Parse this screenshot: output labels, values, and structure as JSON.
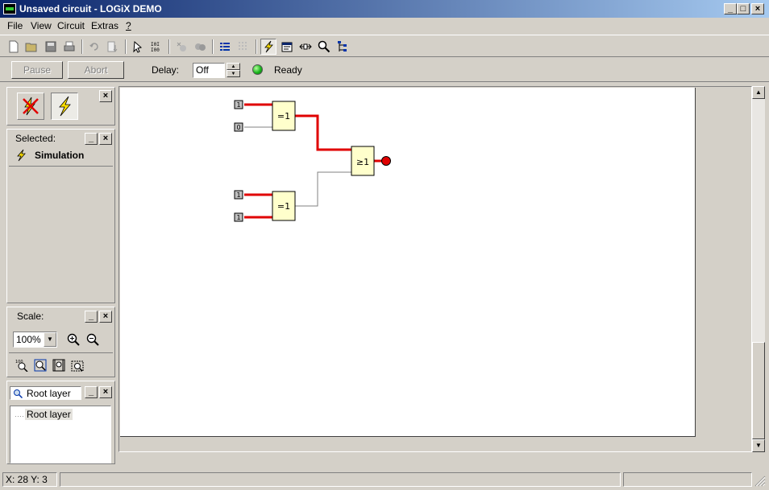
{
  "window": {
    "title": "Unsaved circuit - LOGiX DEMO",
    "minimize": "_",
    "maximize": "□",
    "close": "×"
  },
  "menu": [
    {
      "label": "File"
    },
    {
      "label": "View"
    },
    {
      "label": "Circuit"
    },
    {
      "label": "Extras"
    },
    {
      "label": "?"
    }
  ],
  "toolbar": {
    "icons": [
      "new-icon",
      "open-icon",
      "save-icon",
      "print-icon",
      "undo-icon",
      "export-icon",
      "select-icon",
      "binary-icon",
      "tool-a-icon",
      "tool-b-icon",
      "list-icon",
      "grid-icon",
      "simulation-icon",
      "properties-icon",
      "connect-icon",
      "zoom-icon",
      "hierarchy-icon"
    ]
  },
  "simbar": {
    "pause_label": "Pause",
    "abort_label": "Abort",
    "delay_label": "Delay:",
    "delay_value": "Off",
    "status_text": "Ready",
    "status_color": "#19b51c"
  },
  "mode_panel": {
    "close": "×"
  },
  "selected_panel": {
    "title": "Selected:",
    "item": "Simulation",
    "minimize": "_",
    "close": "×"
  },
  "scale_panel": {
    "title": "Scale:",
    "value": "100%",
    "minimize": "_",
    "close": "×"
  },
  "layer_panel": {
    "search_value": "Root layer",
    "minimize": "_",
    "close": "×",
    "tree": [
      "Root layer"
    ]
  },
  "circuit": {
    "inputs": [
      "1",
      "0",
      "1",
      "1"
    ],
    "gates": [
      "=1",
      "=1",
      "≥1"
    ],
    "active_wire_color": "#e00000",
    "inactive_wire_color": "#808080",
    "gate_fill": "#ffffcc",
    "output_led_color": "#e00000"
  },
  "statusbar": {
    "coords": "X: 28 Y: 3"
  }
}
